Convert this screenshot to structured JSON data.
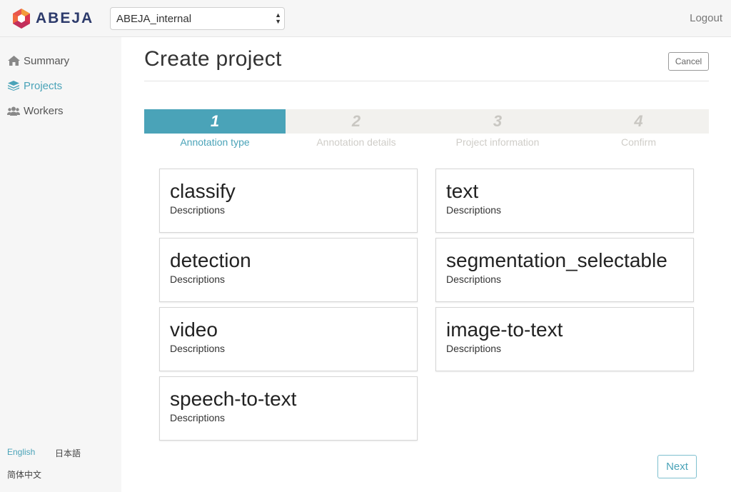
{
  "header": {
    "brand": "ABEJA",
    "organization": "ABEJA_internal",
    "logout_label": "Logout"
  },
  "sidebar": {
    "items": [
      {
        "label": "Summary",
        "icon": "home-icon"
      },
      {
        "label": "Projects",
        "icon": "layers-icon",
        "active": true
      },
      {
        "label": "Workers",
        "icon": "users-icon"
      }
    ],
    "languages": [
      "English",
      "日本語",
      "简体中文"
    ],
    "active_language": "English"
  },
  "main": {
    "title": "Create project",
    "cancel_label": "Cancel",
    "next_label": "Next",
    "steps": [
      {
        "number": "1",
        "label": "Annotation type",
        "active": true
      },
      {
        "number": "2",
        "label": "Annotation details"
      },
      {
        "number": "3",
        "label": "Project information"
      },
      {
        "number": "4",
        "label": "Confirm"
      }
    ],
    "types": [
      {
        "title": "classify",
        "description": "Descriptions"
      },
      {
        "title": "text",
        "description": "Descriptions"
      },
      {
        "title": "detection",
        "description": "Descriptions"
      },
      {
        "title": "segmentation_selectable",
        "description": "Descriptions"
      },
      {
        "title": "video",
        "description": "Descriptions"
      },
      {
        "title": "image-to-text",
        "description": "Descriptions"
      },
      {
        "title": "speech-to-text",
        "description": "Descriptions"
      }
    ]
  },
  "colors": {
    "accent": "#4aa3b8",
    "brand_text": "#2c3a6b",
    "step_inactive": "#f2f1ee"
  }
}
